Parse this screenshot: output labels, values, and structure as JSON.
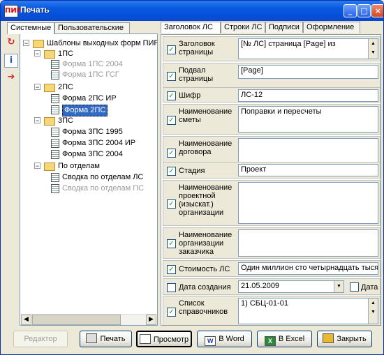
{
  "window": {
    "title": "Печать",
    "app_icon_text": "ПИР"
  },
  "left_tabs": [
    "Системные",
    "Пользовательские"
  ],
  "tree": [
    {
      "label": "Шаблоны выходных форм ПИР",
      "type": "folder",
      "expander": "−",
      "dim": false
    },
    {
      "label": "1ПС",
      "type": "folder",
      "expander": "−",
      "dim": false
    },
    {
      "label": "Форма 1ПС 2004",
      "type": "doc",
      "dim": true
    },
    {
      "label": "Форма 1ПС ГСГ",
      "type": "doc",
      "dim": true
    },
    {
      "label": "2ПС",
      "type": "folder",
      "expander": "−",
      "dim": false
    },
    {
      "label": "Форма 2ПС ИР",
      "type": "doc",
      "dim": false
    },
    {
      "label": "Форма 2ПС",
      "type": "doc",
      "dim": false,
      "selected": true
    },
    {
      "label": "3ПС",
      "type": "folder",
      "expander": "−",
      "dim": false
    },
    {
      "label": "Форма 3ПС 1995",
      "type": "doc",
      "dim": false
    },
    {
      "label": "Форма 3ПС 2004 ИР",
      "type": "doc",
      "dim": false
    },
    {
      "label": "Форма 3ПС 2004",
      "type": "doc",
      "dim": false
    },
    {
      "label": "По отделам",
      "type": "folder",
      "expander": "−",
      "dim": false
    },
    {
      "label": "Сводка по отделам ЛС",
      "type": "doc",
      "dim": false
    },
    {
      "label": "Сводка по отделам ПС",
      "type": "doc",
      "dim": true
    }
  ],
  "right_tabs": [
    "Заголовок ЛС",
    "Строки ЛС",
    "Подписи",
    "Оформление"
  ],
  "rows": [
    {
      "label": "Заголовок страницы",
      "value": "[№ ЛС] страница [Page] из",
      "checked": true
    },
    {
      "label": "Подвал страницы",
      "value": "[Page]",
      "checked": true
    },
    {
      "label": "Шифр",
      "value": "ЛС-12",
      "checked": true
    },
    {
      "label": "Наименование сметы",
      "value": "Поправки и пересчеты",
      "checked": true
    },
    {
      "label": "Наименование договора",
      "value": "",
      "checked": true
    },
    {
      "label": "Стадия",
      "value": "Проект",
      "checked": true
    },
    {
      "label": "Наименование проектной (изыскат.) организации",
      "value": "",
      "checked": true
    },
    {
      "label": "Наименование организации заказчика",
      "value": "",
      "checked": true
    },
    {
      "label": "Стоимость ЛС",
      "value": "Один миллион сто четырнадцать тысяч",
      "checked": true
    },
    {
      "label": "Дата создания",
      "value": "21.05.2009",
      "checked": false,
      "extra_label": "Дата и"
    },
    {
      "label": "Список справочников",
      "value": "1) СБЦ-01-01",
      "checked": true
    }
  ],
  "buttons": {
    "editor": "Редактор",
    "print": "Печать",
    "preview": "Просмотр",
    "word": "В Word",
    "excel": "В Excel",
    "close": "Закрыть"
  },
  "icons": {
    "word": "W",
    "excel": "X"
  }
}
